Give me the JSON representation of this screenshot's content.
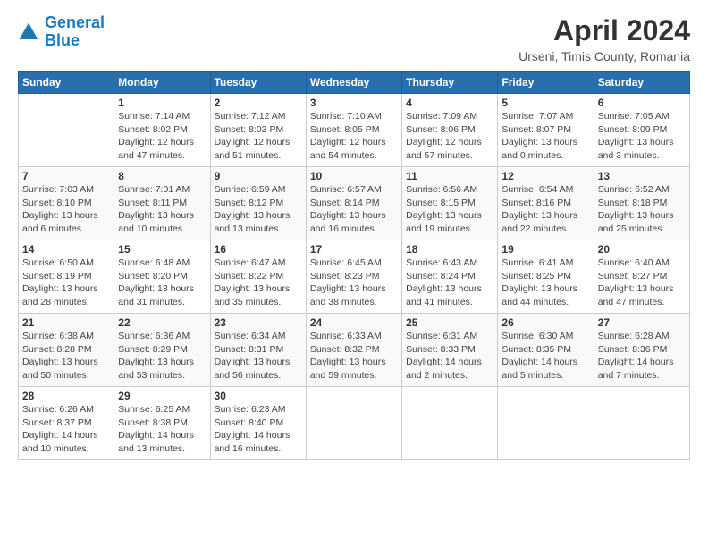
{
  "header": {
    "logo_line1": "General",
    "logo_line2": "Blue",
    "title": "April 2024",
    "subtitle": "Urseni, Timis County, Romania"
  },
  "weekdays": [
    "Sunday",
    "Monday",
    "Tuesday",
    "Wednesday",
    "Thursday",
    "Friday",
    "Saturday"
  ],
  "weeks": [
    [
      {
        "num": "",
        "info": ""
      },
      {
        "num": "1",
        "info": "Sunrise: 7:14 AM\nSunset: 8:02 PM\nDaylight: 12 hours\nand 47 minutes."
      },
      {
        "num": "2",
        "info": "Sunrise: 7:12 AM\nSunset: 8:03 PM\nDaylight: 12 hours\nand 51 minutes."
      },
      {
        "num": "3",
        "info": "Sunrise: 7:10 AM\nSunset: 8:05 PM\nDaylight: 12 hours\nand 54 minutes."
      },
      {
        "num": "4",
        "info": "Sunrise: 7:09 AM\nSunset: 8:06 PM\nDaylight: 12 hours\nand 57 minutes."
      },
      {
        "num": "5",
        "info": "Sunrise: 7:07 AM\nSunset: 8:07 PM\nDaylight: 13 hours\nand 0 minutes."
      },
      {
        "num": "6",
        "info": "Sunrise: 7:05 AM\nSunset: 8:09 PM\nDaylight: 13 hours\nand 3 minutes."
      }
    ],
    [
      {
        "num": "7",
        "info": "Sunrise: 7:03 AM\nSunset: 8:10 PM\nDaylight: 13 hours\nand 6 minutes."
      },
      {
        "num": "8",
        "info": "Sunrise: 7:01 AM\nSunset: 8:11 PM\nDaylight: 13 hours\nand 10 minutes."
      },
      {
        "num": "9",
        "info": "Sunrise: 6:59 AM\nSunset: 8:12 PM\nDaylight: 13 hours\nand 13 minutes."
      },
      {
        "num": "10",
        "info": "Sunrise: 6:57 AM\nSunset: 8:14 PM\nDaylight: 13 hours\nand 16 minutes."
      },
      {
        "num": "11",
        "info": "Sunrise: 6:56 AM\nSunset: 8:15 PM\nDaylight: 13 hours\nand 19 minutes."
      },
      {
        "num": "12",
        "info": "Sunrise: 6:54 AM\nSunset: 8:16 PM\nDaylight: 13 hours\nand 22 minutes."
      },
      {
        "num": "13",
        "info": "Sunrise: 6:52 AM\nSunset: 8:18 PM\nDaylight: 13 hours\nand 25 minutes."
      }
    ],
    [
      {
        "num": "14",
        "info": "Sunrise: 6:50 AM\nSunset: 8:19 PM\nDaylight: 13 hours\nand 28 minutes."
      },
      {
        "num": "15",
        "info": "Sunrise: 6:48 AM\nSunset: 8:20 PM\nDaylight: 13 hours\nand 31 minutes."
      },
      {
        "num": "16",
        "info": "Sunrise: 6:47 AM\nSunset: 8:22 PM\nDaylight: 13 hours\nand 35 minutes."
      },
      {
        "num": "17",
        "info": "Sunrise: 6:45 AM\nSunset: 8:23 PM\nDaylight: 13 hours\nand 38 minutes."
      },
      {
        "num": "18",
        "info": "Sunrise: 6:43 AM\nSunset: 8:24 PM\nDaylight: 13 hours\nand 41 minutes."
      },
      {
        "num": "19",
        "info": "Sunrise: 6:41 AM\nSunset: 8:25 PM\nDaylight: 13 hours\nand 44 minutes."
      },
      {
        "num": "20",
        "info": "Sunrise: 6:40 AM\nSunset: 8:27 PM\nDaylight: 13 hours\nand 47 minutes."
      }
    ],
    [
      {
        "num": "21",
        "info": "Sunrise: 6:38 AM\nSunset: 8:28 PM\nDaylight: 13 hours\nand 50 minutes."
      },
      {
        "num": "22",
        "info": "Sunrise: 6:36 AM\nSunset: 8:29 PM\nDaylight: 13 hours\nand 53 minutes."
      },
      {
        "num": "23",
        "info": "Sunrise: 6:34 AM\nSunset: 8:31 PM\nDaylight: 13 hours\nand 56 minutes."
      },
      {
        "num": "24",
        "info": "Sunrise: 6:33 AM\nSunset: 8:32 PM\nDaylight: 13 hours\nand 59 minutes."
      },
      {
        "num": "25",
        "info": "Sunrise: 6:31 AM\nSunset: 8:33 PM\nDaylight: 14 hours\nand 2 minutes."
      },
      {
        "num": "26",
        "info": "Sunrise: 6:30 AM\nSunset: 8:35 PM\nDaylight: 14 hours\nand 5 minutes."
      },
      {
        "num": "27",
        "info": "Sunrise: 6:28 AM\nSunset: 8:36 PM\nDaylight: 14 hours\nand 7 minutes."
      }
    ],
    [
      {
        "num": "28",
        "info": "Sunrise: 6:26 AM\nSunset: 8:37 PM\nDaylight: 14 hours\nand 10 minutes."
      },
      {
        "num": "29",
        "info": "Sunrise: 6:25 AM\nSunset: 8:38 PM\nDaylight: 14 hours\nand 13 minutes."
      },
      {
        "num": "30",
        "info": "Sunrise: 6:23 AM\nSunset: 8:40 PM\nDaylight: 14 hours\nand 16 minutes."
      },
      {
        "num": "",
        "info": ""
      },
      {
        "num": "",
        "info": ""
      },
      {
        "num": "",
        "info": ""
      },
      {
        "num": "",
        "info": ""
      }
    ]
  ]
}
